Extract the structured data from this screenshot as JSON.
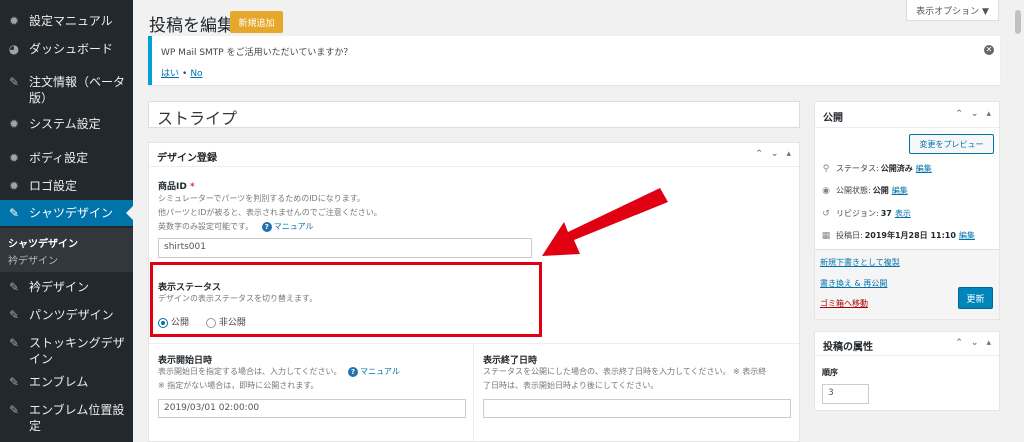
{
  "sidebar": {
    "items": [
      {
        "label": "設定マニュアル",
        "icon": "gear-icon"
      },
      {
        "label": "ダッシュボード",
        "icon": "dashboard-icon"
      },
      {
        "label": "注文情報（ベータ版）",
        "icon": "pin-icon"
      },
      {
        "label": "システム設定",
        "icon": "gear-icon"
      },
      {
        "label": "ボディ設定",
        "icon": "gear-icon"
      },
      {
        "label": "ロゴ設定",
        "icon": "gear-icon"
      },
      {
        "label": "シャツデザイン",
        "icon": "pin-icon"
      },
      {
        "label": "衿デザイン",
        "icon": "pin-icon"
      },
      {
        "label": "パンツデザイン",
        "icon": "pin-icon"
      },
      {
        "label": "ストッキングデザイン",
        "icon": "pin-icon"
      },
      {
        "label": "エンブレム",
        "icon": "pin-icon"
      },
      {
        "label": "エンブレム位置設定",
        "icon": "pin-icon"
      }
    ],
    "submenu": [
      "シャツデザイン",
      "衿デザイン"
    ]
  },
  "header": {
    "title": "投稿を編集",
    "add_new": "新規追加",
    "screen_options": "表示オプション ▼"
  },
  "notice": {
    "text": "WP Mail SMTP をご活用いただいていますか？",
    "yes": "はい",
    "no": "No"
  },
  "post_title": "ストライプ",
  "design_box": {
    "title": "デザイン登録",
    "product_id": {
      "label": "商品ID",
      "required": "*",
      "desc1": "シミュレーターでパーツを判別するためのIDになります。",
      "desc2": "他パーツとIDが被ると、表示されませんのでご注意ください。",
      "desc3": "英数字のみ設定可能です。",
      "manual": "マニュアル",
      "value": "shirts001"
    },
    "status": {
      "label": "表示ステータス",
      "desc": "デザインの表示ステータスを切り替えます。",
      "opt_public": "公開",
      "opt_private": "非公開",
      "selected": "公開"
    },
    "start": {
      "label": "表示開始日時",
      "desc1": "表示開始日を指定する場合は、入力してください。",
      "manual": "マニュアル",
      "desc2": "※ 指定がない場合は，即時に公開されます。",
      "value": "2019/03/01 02:00:00"
    },
    "end": {
      "label": "表示終了日時",
      "desc1": "ステータスを公開にした場合の、表示終了日時を入力してください。 ※ 表示終",
      "desc2": "了日時は、表示開始日時より後にしてください。",
      "value": ""
    }
  },
  "publish": {
    "title": "公開",
    "preview": "変更をプレビュー",
    "status_label": "ステータス:",
    "status_value": "公開済み",
    "visibility_label": "公開状態:",
    "visibility_value": "公開",
    "revision_label": "リビジョン:",
    "revision_value": "37",
    "revision_link": "表示",
    "date_label": "投稿日:",
    "date_value": "2019年1月28日 11:10",
    "edit": "編集",
    "draft_link": "新規下書きとして複製",
    "rewrite_link": "書き換え & 再公開",
    "trash_link": "ゴミ箱へ移動",
    "update": "更新"
  },
  "attributes": {
    "title": "投稿の属性",
    "order_label": "順序",
    "order_value": "3"
  },
  "colors": {
    "sidebar": "#23282d",
    "active": "#0073aa",
    "highlight": "#e00012",
    "accent_button": "#e6a72a"
  }
}
